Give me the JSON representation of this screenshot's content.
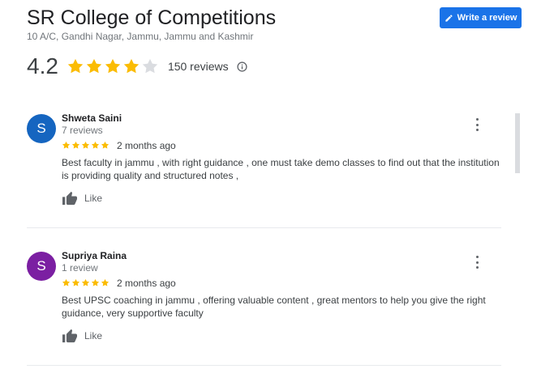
{
  "business": {
    "name": "SR College of Competitions",
    "address": "10 A/C, Gandhi Nagar, Jammu, Jammu and Kashmir"
  },
  "write_review": {
    "label": "Write a review",
    "icon": "pencil-icon"
  },
  "summary": {
    "rating": "4.2",
    "rating_value": 4.2,
    "stars_filled": 4,
    "stars_total": 5,
    "reviews_label": "150 reviews",
    "info_icon": "info-icon"
  },
  "colors": {
    "star": "#fbbc04",
    "star_empty": "#dadce0",
    "button": "#1a73e8",
    "avatar_shweta": "#1565c0",
    "avatar_supriya": "#7b1fa2"
  },
  "reviews": [
    {
      "initial": "S",
      "name": "Shweta Saini",
      "meta": "7 reviews",
      "stars": 5,
      "date": "2 months ago",
      "text": "Best faculty in jammu , with right guidance , one must take demo classes to find out that the institution is providing quality and structured notes ,",
      "like_label": "Like"
    },
    {
      "initial": "S",
      "name": "Supriya Raina",
      "meta": "1 review",
      "stars": 5,
      "date": "2 months ago",
      "text": "Best UPSC coaching in jammu , offering valuable content , great mentors to help you give the right guidance, very supportive faculty",
      "like_label": "Like"
    }
  ]
}
